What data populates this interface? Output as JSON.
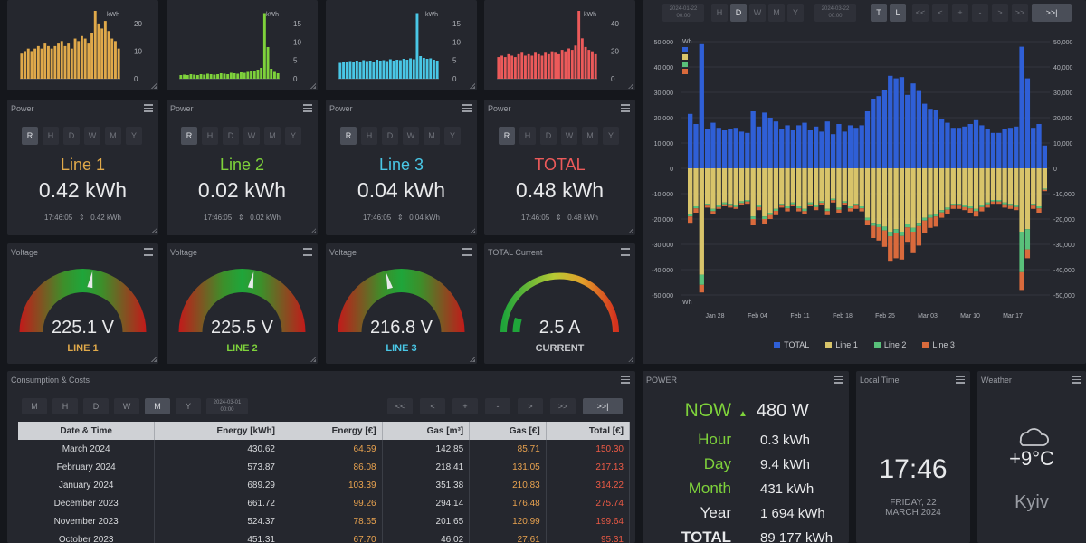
{
  "colors": {
    "line1": "#e0a94a",
    "line2": "#7ed23b",
    "line3": "#49c7e6",
    "total": "#ec5a5a",
    "total_bar": "#2f5fd6",
    "line1_bar": "#d8c46a",
    "line2_bar": "#59c07a",
    "line3_bar": "#d96a3c"
  },
  "mini_charts": [
    {
      "unit": "kWh",
      "ticks": [
        "20",
        "10",
        "0"
      ],
      "values": [
        10,
        11,
        12,
        11,
        12,
        13,
        12,
        14,
        13,
        12,
        13,
        14,
        15,
        13,
        14,
        12,
        16,
        15,
        17,
        16,
        14,
        18,
        27,
        22,
        20,
        23,
        19,
        16,
        15,
        12
      ]
    },
    {
      "unit": "kWh",
      "ticks": [
        "15",
        "10",
        "5",
        "0"
      ],
      "values": [
        0.8,
        0.9,
        0.8,
        1,
        0.9,
        0.8,
        1,
        0.9,
        1.1,
        1,
        0.9,
        1,
        1.2,
        1.1,
        1,
        1.3,
        1.2,
        1.1,
        1.4,
        1.3,
        1.5,
        1.6,
        1.8,
        2,
        2.4,
        14.5,
        7,
        2.2,
        1.5,
        1.2
      ]
    },
    {
      "unit": "kWh",
      "ticks": [
        "15",
        "10",
        "5",
        "0"
      ],
      "values": [
        3.5,
        3.8,
        3.6,
        3.9,
        3.7,
        4,
        3.8,
        4.1,
        3.9,
        4,
        3.8,
        4.2,
        4,
        4.1,
        3.9,
        4.3,
        4,
        4.2,
        4.1,
        4.4,
        4.2,
        4.5,
        4.3,
        14.5,
        5,
        4.6,
        4.4,
        4.5,
        4.2,
        4
      ]
    },
    {
      "unit": "kWh",
      "ticks": [
        "40",
        "20",
        "0"
      ],
      "values": [
        15,
        16,
        15,
        17,
        16,
        15,
        17,
        18,
        16,
        17,
        16,
        18,
        17,
        16,
        18,
        17,
        19,
        18,
        17,
        20,
        19,
        21,
        20,
        23,
        47,
        28,
        22,
        20,
        19,
        17
      ]
    }
  ],
  "power_cards": [
    {
      "title": "Power",
      "buttons": [
        "R",
        "H",
        "D",
        "W",
        "M",
        "Y"
      ],
      "name": "Line 1",
      "value": "0.42 kWh",
      "time": "17:46:05",
      "foot": "0.42 kWh"
    },
    {
      "title": "Power",
      "buttons": [
        "R",
        "H",
        "D",
        "W",
        "M",
        "Y"
      ],
      "name": "Line 2",
      "value": "0.02 kWh",
      "time": "17:46:05",
      "foot": "0.02 kWh"
    },
    {
      "title": "Power",
      "buttons": [
        "R",
        "H",
        "D",
        "W",
        "M",
        "Y"
      ],
      "name": "Line 3",
      "value": "0.04 kWh",
      "time": "17:46:05",
      "foot": "0.04 kWh"
    },
    {
      "title": "Power",
      "buttons": [
        "R",
        "H",
        "D",
        "W",
        "M",
        "Y"
      ],
      "name": "TOTAL",
      "value": "0.48 kWh",
      "time": "17:46:05",
      "foot": "0.48 kWh"
    }
  ],
  "gauges": [
    {
      "title": "Voltage",
      "value": "225.1 V",
      "label": "LINE 1",
      "level": 0.55,
      "type": "voltage"
    },
    {
      "title": "Voltage",
      "value": "225.5 V",
      "label": "LINE 2",
      "level": 0.56,
      "type": "voltage"
    },
    {
      "title": "Voltage",
      "value": "216.8 V",
      "label": "LINE 3",
      "level": 0.42,
      "type": "voltage"
    },
    {
      "title": "TOTAL Current",
      "value": "2.5 A",
      "label": "CURRENT",
      "level": 0.1,
      "type": "current"
    }
  ],
  "big_chart": {
    "date_from": "2024-01-22\n00:00",
    "date_to": "2024-03-22\n00:00",
    "buttons": [
      "H",
      "D",
      "W",
      "M",
      "Y"
    ],
    "active_button": "D",
    "toggles": [
      "T",
      "L"
    ],
    "nav": [
      "<<",
      "<",
      "+",
      "-",
      ">",
      ">>",
      ">>|"
    ],
    "unit": "Wh",
    "y_ticks": [
      "50,000",
      "40,000",
      "30,000",
      "20,000",
      "10,000",
      "0",
      "-10,000",
      "-20,000",
      "-30,000",
      "-40,000",
      "-50,000"
    ],
    "x_ticks": [
      "Jan 28",
      "Feb 04",
      "Feb 11",
      "Feb 18",
      "Feb 25",
      "Mar 03",
      "Mar 10",
      "Mar 17"
    ],
    "legend": [
      "TOTAL",
      "Line 1",
      "Line 2",
      "Line 3"
    ]
  },
  "chart_data": {
    "type": "bar",
    "ylim": [
      -50000,
      50000
    ],
    "series": [
      {
        "name": "TOTAL",
        "values": [
          21500,
          17500,
          49000,
          15500,
          18000,
          16000,
          15000,
          15500,
          16000,
          14500,
          14000,
          22500,
          16500,
          22000,
          20000,
          18500,
          15500,
          17000,
          15000,
          17000,
          18000,
          15000,
          16500,
          14500,
          18500,
          13500,
          17500,
          14500,
          17000,
          16000,
          17000,
          22500,
          27500,
          28500,
          31000,
          36500,
          35500,
          36000,
          29000,
          33500,
          30500,
          25500,
          23500,
          23000,
          19500,
          18000,
          16000,
          16000,
          16500,
          17500,
          19000,
          17000,
          15500,
          14000,
          14000,
          15500,
          16000,
          16500,
          48000,
          35500,
          16000,
          17500,
          9000
        ]
      },
      {
        "name": "Line 1",
        "values": [
          -18000,
          -15000,
          -42000,
          -14000,
          -16000,
          -14500,
          -13500,
          -14000,
          -14500,
          -13000,
          -12500,
          -19000,
          -14500,
          -19000,
          -17500,
          -16000,
          -14000,
          -15000,
          -13500,
          -15000,
          -16000,
          -13500,
          -14500,
          -13000,
          -16000,
          -12000,
          -15500,
          -13000,
          -15000,
          -14000,
          -15000,
          -19500,
          -21500,
          -22000,
          -23000,
          -25000,
          -24000,
          -25000,
          -22000,
          -23500,
          -21500,
          -19500,
          -18500,
          -18000,
          -16500,
          -15500,
          -14000,
          -14000,
          -14500,
          -15000,
          -16000,
          -14500,
          -13500,
          -12500,
          -12500,
          -13500,
          -14000,
          -14500,
          -25000,
          -24000,
          -14000,
          -15000,
          -8000
        ]
      },
      {
        "name": "Line 2",
        "values": [
          -1000,
          -800,
          -4000,
          -700,
          -900,
          -800,
          -700,
          -800,
          -800,
          -700,
          -600,
          -1000,
          -800,
          -1000,
          -900,
          -800,
          -700,
          -800,
          -700,
          -800,
          -900,
          -700,
          -800,
          -600,
          -900,
          -600,
          -800,
          -600,
          -800,
          -700,
          -800,
          -1000,
          -1200,
          -1200,
          -1500,
          -1800,
          -1600,
          -1700,
          -1300,
          -1500,
          -1300,
          -1100,
          -1000,
          -1000,
          -900,
          -800,
          -700,
          -700,
          -800,
          -800,
          -900,
          -800,
          -700,
          -600,
          -600,
          -700,
          -800,
          -800,
          -16000,
          -8000,
          -700,
          -800,
          -400
        ]
      },
      {
        "name": "Line 3",
        "values": [
          -2500,
          -1700,
          -3000,
          -800,
          -1100,
          -700,
          -800,
          -700,
          -700,
          -800,
          -900,
          -2500,
          -1200,
          -2000,
          -1600,
          -1700,
          -800,
          -1200,
          -800,
          -1200,
          -1100,
          -800,
          -1200,
          -900,
          -1600,
          -900,
          -1200,
          -900,
          -1200,
          -1300,
          -1200,
          -2000,
          -4800,
          -5300,
          -6500,
          -9700,
          -9900,
          -9300,
          -5700,
          -8500,
          -7700,
          -4900,
          -4000,
          -4000,
          -2100,
          -1700,
          -1300,
          -1300,
          -1200,
          -1700,
          -2100,
          -1700,
          -1300,
          -900,
          -900,
          -1300,
          -1200,
          -1200,
          -7000,
          -3500,
          -1300,
          -1700,
          -600
        ]
      }
    ]
  },
  "consumption": {
    "title": "Consumption & Costs",
    "buttons": [
      "M",
      "H",
      "D",
      "W",
      "M",
      "Y"
    ],
    "active_index": 4,
    "date": "2024-03-01\n00:00",
    "nav": [
      "<<",
      "<",
      "+",
      "-",
      ">",
      ">>",
      ">>|"
    ],
    "headers": [
      "Date & Time",
      "Energy [kWh]",
      "Energy [€]",
      "Gas [m³]",
      "Gas [€]",
      "Total [€]"
    ],
    "rows": [
      [
        "March 2024",
        "430.62",
        "64.59",
        "142.85",
        "85.71",
        "150.30"
      ],
      [
        "February 2024",
        "573.87",
        "86.08",
        "218.41",
        "131.05",
        "217.13"
      ],
      [
        "January 2024",
        "689.29",
        "103.39",
        "351.38",
        "210.83",
        "314.22"
      ],
      [
        "December 2023",
        "661.72",
        "99.26",
        "294.14",
        "176.48",
        "275.74"
      ],
      [
        "November 2023",
        "524.37",
        "78.65",
        "201.65",
        "120.99",
        "199.64"
      ],
      [
        "October 2023",
        "451.31",
        "67.70",
        "46.02",
        "27.61",
        "95.31"
      ]
    ]
  },
  "power_summary": {
    "title": "POWER",
    "rows": [
      {
        "label": "NOW",
        "value": "480 W"
      },
      {
        "label": "Hour",
        "value": "0.3 kWh"
      },
      {
        "label": "Day",
        "value": "9.4 kWh"
      },
      {
        "label": "Month",
        "value": "431 kWh"
      },
      {
        "label": "Year",
        "value": "1 694 kWh"
      },
      {
        "label": "TOTAL",
        "value": "89 177 kWh"
      }
    ]
  },
  "local_time": {
    "title": "Local Time",
    "time": "17:46",
    "date_line1": "FRIDAY, 22",
    "date_line2": "MARCH 2024"
  },
  "weather": {
    "title": "Weather",
    "temp": "+9°C",
    "city": "Kyiv",
    "icon": "cloud-icon"
  }
}
